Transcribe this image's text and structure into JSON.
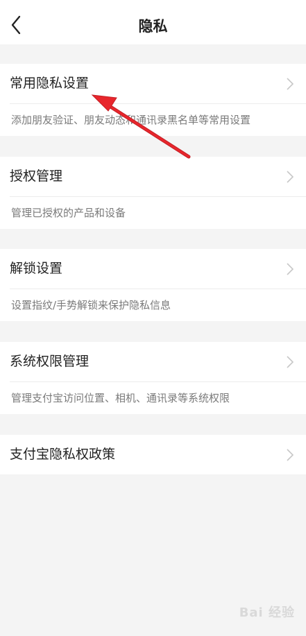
{
  "header": {
    "title": "隐私"
  },
  "groups": [
    {
      "label": "常用隐私设置",
      "desc": "添加朋友验证、朋友动态和通讯录黑名单等常用设置"
    },
    {
      "label": "授权管理",
      "desc": "管理已授权的产品和设备"
    },
    {
      "label": "解锁设置",
      "desc": "设置指纹/手势解锁来保护隐私信息"
    },
    {
      "label": "系统权限管理",
      "desc": "管理支付宝访问位置、相机、通讯录等系统权限"
    },
    {
      "label": "支付宝隐私权政策"
    }
  ],
  "icons": {
    "back": "back-arrow-icon",
    "chevron": "chevron-right-icon"
  },
  "watermark": "Bai 经验",
  "colors": {
    "annotation_arrow": "#e8262c",
    "background": "#f4f4f4",
    "card": "#ffffff"
  }
}
